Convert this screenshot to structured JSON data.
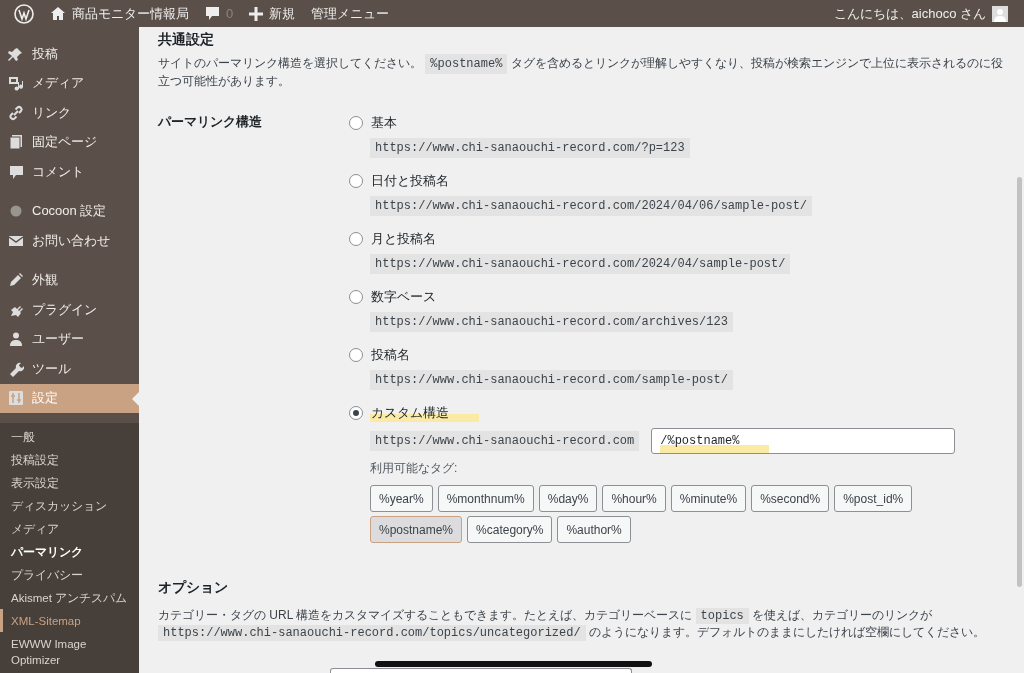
{
  "admin_bar": {
    "site_name": "商品モニター情報局",
    "comment_count": "0",
    "new_label": "新規",
    "admin_menu": "管理メニュー",
    "greeting": "こんにちは、aichoco さん"
  },
  "sidebar": {
    "groups": [
      [
        {
          "label": "投稿",
          "selected": false
        },
        {
          "label": "メディア",
          "selected": false
        },
        {
          "label": "リンク",
          "selected": false
        },
        {
          "label": "固定ページ",
          "selected": false
        },
        {
          "label": "コメント",
          "selected": false
        }
      ],
      [
        {
          "label": "Cocoon 設定",
          "selected": false
        },
        {
          "label": "お問い合わせ",
          "selected": false
        }
      ],
      [
        {
          "label": "外観",
          "selected": false
        },
        {
          "label": "プラグイン",
          "selected": false
        },
        {
          "label": "ユーザー",
          "selected": false
        },
        {
          "label": "ツール",
          "selected": false
        },
        {
          "label": "設定",
          "selected": true
        }
      ]
    ],
    "submenu": [
      {
        "label": "一般",
        "selected": false,
        "hovered": false
      },
      {
        "label": "投稿設定",
        "selected": false,
        "hovered": false
      },
      {
        "label": "表示設定",
        "selected": false,
        "hovered": false
      },
      {
        "label": "ディスカッション",
        "selected": false,
        "hovered": false
      },
      {
        "label": "メディア",
        "selected": false,
        "hovered": false
      },
      {
        "label": "パーマリンク",
        "selected": true,
        "hovered": false
      },
      {
        "label": "プライバシー",
        "selected": false,
        "hovered": false
      },
      {
        "label": "Akismet アンチスパム",
        "selected": false,
        "hovered": false
      },
      {
        "label": "XML-Sitemap",
        "selected": false,
        "hovered": true
      },
      {
        "label": "EWWW Image Optimizer",
        "selected": false,
        "hovered": false
      }
    ]
  },
  "content": {
    "heading": "共通設定",
    "intro": [
      "サイトのパーマリンク構造を選択してください。",
      "%postname%",
      "タグを含めるとリンクが理解しやすくなり、投稿が検索エンジンで上位に表示されるのに役立つ可能性があります。"
    ],
    "permalink_label": "パーマリンク構造",
    "options": [
      {
        "kind": "preset",
        "label": "基本",
        "url": "https://www.chi-sanaouchi-record.com/?p=123",
        "selected": false,
        "highlighted": false
      },
      {
        "kind": "preset",
        "label": "日付と投稿名",
        "url": "https://www.chi-sanaouchi-record.com/2024/04/06/sample-post/",
        "selected": false,
        "highlighted": false
      },
      {
        "kind": "preset",
        "label": "月と投稿名",
        "url": "https://www.chi-sanaouchi-record.com/2024/04/sample-post/",
        "selected": false,
        "highlighted": false
      },
      {
        "kind": "preset",
        "label": "数字ベース",
        "url": "https://www.chi-sanaouchi-record.com/archives/123",
        "selected": false,
        "highlighted": false
      },
      {
        "kind": "preset",
        "label": "投稿名",
        "url": "https://www.chi-sanaouchi-record.com/sample-post/",
        "selected": false,
        "highlighted": false
      },
      {
        "kind": "custom",
        "label": "カスタム構造",
        "url": "https://www.chi-sanaouchi-record.com",
        "value": "/%postname%",
        "selected": true,
        "highlighted": true
      }
    ],
    "tags_label": "利用可能なタグ:",
    "tags": [
      {
        "label": "%year%",
        "selected": false
      },
      {
        "label": "%monthnum%",
        "selected": false
      },
      {
        "label": "%day%",
        "selected": false
      },
      {
        "label": "%hour%",
        "selected": false
      },
      {
        "label": "%minute%",
        "selected": false
      },
      {
        "label": "%second%",
        "selected": false
      },
      {
        "label": "%post_id%",
        "selected": false
      },
      {
        "label": "%postname%",
        "selected": true
      },
      {
        "label": "%category%",
        "selected": false
      },
      {
        "label": "%author%",
        "selected": false
      }
    ],
    "options_heading": "オプション",
    "options_text": [
      "カテゴリー・タグの URL 構造をカスタマイズすることもできます。たとえば、カテゴリーベースに",
      "topics",
      "を使えば、カテゴリーのリンクが",
      "https://www.chi-sanaouchi-record.com/topics/uncategorized/",
      "のようになります。デフォルトのままにしたければ空欄にしてください。"
    ]
  }
}
